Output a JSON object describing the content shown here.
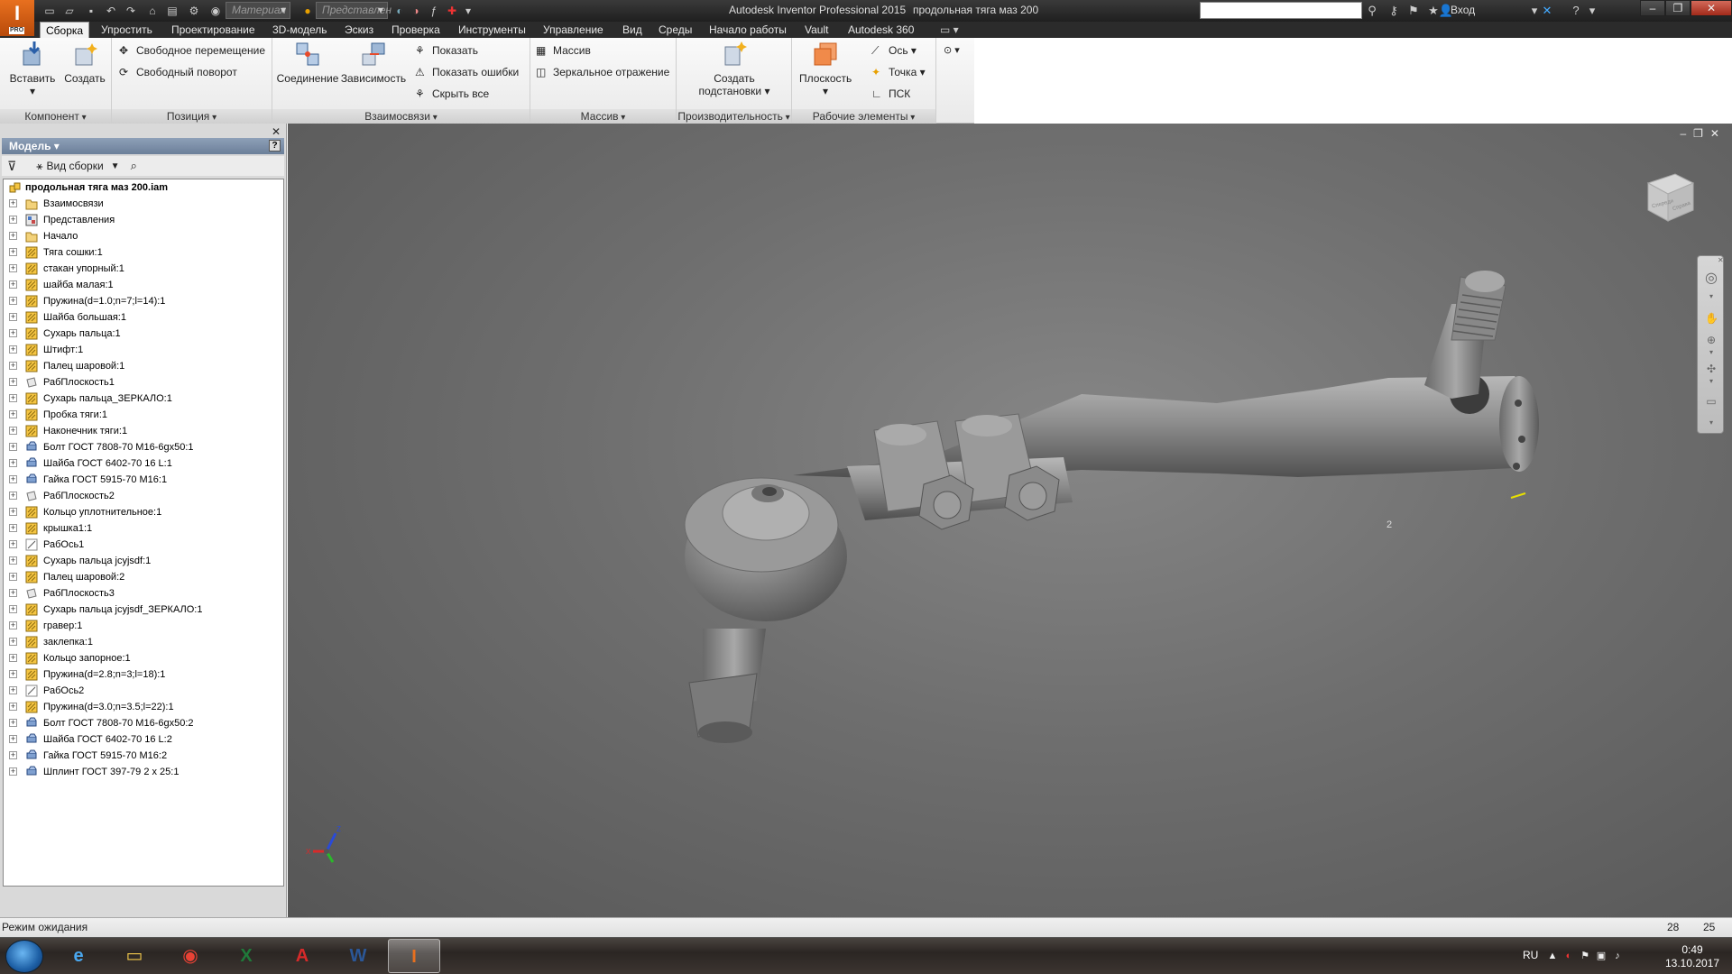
{
  "titlebar": {
    "app_logo": "I",
    "app_logo_sub": "PRO",
    "material_placeholder": "Материал",
    "appearance_placeholder": "Представлен",
    "app_name": "Autodesk Inventor Professional 2015",
    "document_name": "продольная тяга маз 200",
    "sign_in": "Вход"
  },
  "tabs": [
    {
      "label": "Сборка",
      "active": true
    },
    {
      "label": "Упростить"
    },
    {
      "label": "Проектирование"
    },
    {
      "label": "3D-модель"
    },
    {
      "label": "Эскиз"
    },
    {
      "label": "Проверка"
    },
    {
      "label": "Инструменты"
    },
    {
      "label": "Управление"
    },
    {
      "label": "Вид"
    },
    {
      "label": "Среды"
    },
    {
      "label": "Начало работы"
    },
    {
      "label": "Vault"
    },
    {
      "label": "Autodesk 360"
    }
  ],
  "ribbon": {
    "component": {
      "title": "Компонент",
      "insert": "Вставить",
      "create": "Создать"
    },
    "position": {
      "title": "Позиция",
      "free_move": "Свободное перемещение",
      "free_rotate": "Свободный поворот"
    },
    "relationships": {
      "title": "Взаимосвязи",
      "joint": "Соединение",
      "constrain": "Зависимость",
      "show": "Показать",
      "show_errors": "Показать ошибки",
      "hide_all": "Скрыть все"
    },
    "pattern": {
      "title": "Массив",
      "pattern": "Массив",
      "mirror": "Зеркальное отражение"
    },
    "productivity": {
      "title": "Производительность",
      "substitute_line1": "Создать",
      "substitute_line2": "подстановки"
    },
    "work_features": {
      "title": "Рабочие элементы",
      "plane": "Плоскость",
      "axis": "Ось",
      "point": "Точка",
      "ucs": "ПСК"
    }
  },
  "browser": {
    "header": "Модель",
    "help": "?",
    "view_label": "Вид сборки",
    "root": "продольная тяга маз 200.iam",
    "items": [
      {
        "label": "Взаимосвязи",
        "icon": "folder"
      },
      {
        "label": "Представления",
        "icon": "representations"
      },
      {
        "label": "Начало",
        "icon": "folder"
      },
      {
        "label": "Тяга сошки:1",
        "icon": "part"
      },
      {
        "label": "стакан упорный:1",
        "icon": "part"
      },
      {
        "label": "шайба малая:1",
        "icon": "part"
      },
      {
        "label": "Пружина(d=1.0;n=7;l=14):1",
        "icon": "part"
      },
      {
        "label": "Шайба большая:1",
        "icon": "part"
      },
      {
        "label": "Сухарь пальца:1",
        "icon": "part"
      },
      {
        "label": "Штифт:1",
        "icon": "part"
      },
      {
        "label": "Палец шаровой:1",
        "icon": "part"
      },
      {
        "label": "РабПлоскость1",
        "icon": "plane"
      },
      {
        "label": "Сухарь пальца_ЗЕРКАЛО:1",
        "icon": "part"
      },
      {
        "label": "Пробка тяги:1",
        "icon": "part"
      },
      {
        "label": "Наконечник тяги:1",
        "icon": "part"
      },
      {
        "label": "Болт ГОСТ 7808-70 М16-6gx50:1",
        "icon": "content"
      },
      {
        "label": "Шайба ГОСТ 6402-70 16 L:1",
        "icon": "content"
      },
      {
        "label": "Гайка ГОСТ 5915-70 М16:1",
        "icon": "content"
      },
      {
        "label": "РабПлоскость2",
        "icon": "plane"
      },
      {
        "label": "Кольцо уплотнительное:1",
        "icon": "part"
      },
      {
        "label": "крышка1:1",
        "icon": "part"
      },
      {
        "label": "РабОсь1",
        "icon": "axis"
      },
      {
        "label": "Сухарь пальца jcyjsdf:1",
        "icon": "part"
      },
      {
        "label": "Палец шаровой:2",
        "icon": "part"
      },
      {
        "label": "РабПлоскость3",
        "icon": "plane"
      },
      {
        "label": "Сухарь пальца jcyjsdf_ЗЕРКАЛО:1",
        "icon": "part"
      },
      {
        "label": "гравер:1",
        "icon": "part"
      },
      {
        "label": "заклепка:1",
        "icon": "part"
      },
      {
        "label": "Кольцо запорное:1",
        "icon": "part"
      },
      {
        "label": "Пружина(d=2.8;n=3;l=18):1",
        "icon": "part"
      },
      {
        "label": "РабОсь2",
        "icon": "axis"
      },
      {
        "label": "Пружина(d=3.0;n=3.5;l=22):1",
        "icon": "part"
      },
      {
        "label": "Болт ГОСТ 7808-70 М16-6gx50:2",
        "icon": "content"
      },
      {
        "label": "Шайба ГОСТ 6402-70 16 L:2",
        "icon": "content"
      },
      {
        "label": "Гайка ГОСТ 5915-70 М16:2",
        "icon": "content"
      },
      {
        "label": "Шплинт ГОСТ 397-79 2 x  25:1",
        "icon": "content"
      }
    ]
  },
  "viewport": {
    "viewcube_front": "Спереди",
    "viewcube_right": "Справа",
    "triad_x": "X",
    "triad_z": "Z"
  },
  "status": {
    "text": "Режим ожидания",
    "count1": "28",
    "count2": "25"
  },
  "taskbar": {
    "apps": [
      "start",
      "internet-explorer",
      "explorer",
      "chrome",
      "excel",
      "autocad",
      "word",
      "inventor"
    ],
    "lang": "RU",
    "time": "0:49",
    "date": "13.10.2017"
  }
}
